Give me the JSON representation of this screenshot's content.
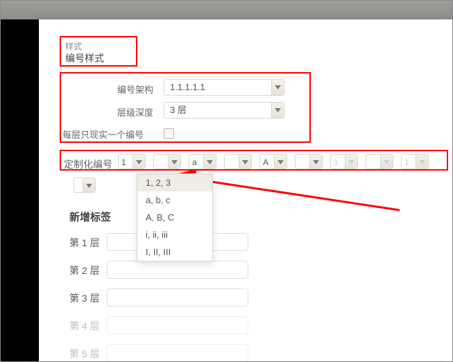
{
  "header": {
    "category": "样式",
    "title": "编号样式"
  },
  "structure": {
    "arch_label": "编号架构",
    "arch_value": "1.1.1.1.1",
    "depth_label": "层级深度",
    "depth_value": "3 层",
    "single_label": "每层只现实一个编号",
    "single_checked": false
  },
  "custom": {
    "label": "定制化编号",
    "slots": [
      "1",
      "",
      "a",
      "",
      "A",
      "",
      "1",
      "",
      "1"
    ]
  },
  "dropdown": {
    "options": [
      "1, 2, 3",
      "a, b, c",
      "A, B, C",
      "i, ii, iii",
      "I, II, III"
    ],
    "selected_index": 0
  },
  "tags": {
    "section_title": "新增标签",
    "levels": [
      "第 1 层",
      "第 2 层",
      "第 3 层",
      "第 4 层",
      "第 5 层"
    ],
    "enabled_until": 3
  }
}
